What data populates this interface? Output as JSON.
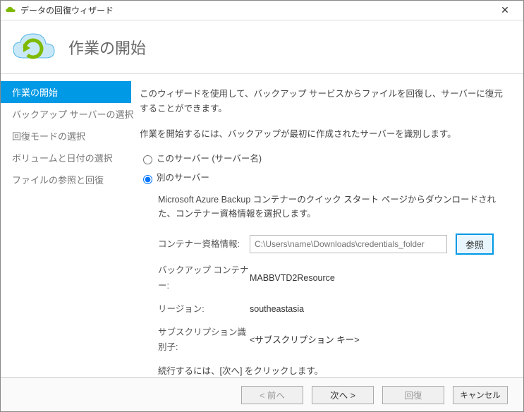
{
  "window": {
    "title": "データの回復ウィザード"
  },
  "header": {
    "heading": "作業の開始"
  },
  "sidebar": {
    "steps": [
      "作業の開始",
      "バックアップ サーバーの選択",
      "回復モードの選択",
      "ボリュームと日付の選択",
      "ファイルの参照と回復"
    ],
    "active_index": 0
  },
  "content": {
    "intro": "このウィザードを使用して、バックアップ サービスからファイルを回復し、サーバーに復元することができます。",
    "identify_prompt": "作業を開始するには、バックアップが最初に作成されたサーバーを識別します。",
    "radio_this_server": "このサーバー (サーバー名)",
    "radio_other_server": "別のサーバー",
    "selected_radio": "other",
    "other_desc": "Microsoft Azure Backup コンテナーのクイック スタート ページからダウンロードされた、コンテナー資格情報を選択します。",
    "fields": {
      "vault_cred_label": "コンテナー資格情報:",
      "vault_cred_placeholder": "C:\\Users\\name\\Downloads\\credentials_folder",
      "browse_label": "参照",
      "backup_container_label": "バックアップ コンテナー:",
      "backup_container_value": "MABBVTD2Resource",
      "region_label": "リージョン:",
      "region_value": "southeastasia",
      "subscription_label": "サブスクリプション識別子:",
      "subscription_value": "<サブスクリプション キー>"
    },
    "continue_note": "続行するには、[次へ] をクリックします。"
  },
  "footer": {
    "back": "< 前へ",
    "next": "次へ >",
    "recover": "回復",
    "cancel": "キャンセル"
  }
}
